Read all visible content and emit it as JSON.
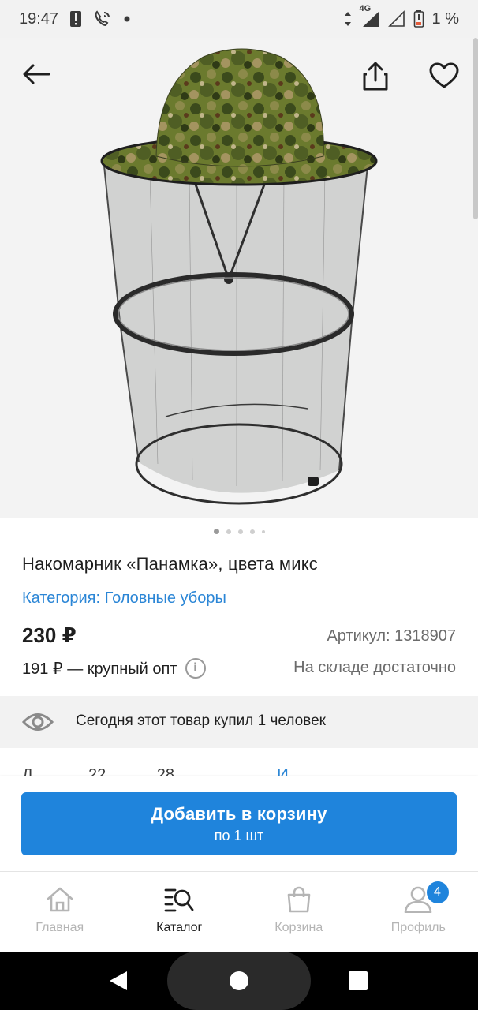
{
  "status_bar": {
    "time": "19:47",
    "network": "4G",
    "battery": "1 %"
  },
  "product": {
    "title": "Накомарник «Панамка», цвета микс",
    "category": "Категория: Головные уборы",
    "price": "230 ₽",
    "article": "Артикул: 1318907",
    "wholesale": "191 ₽ — крупный опт",
    "stock": "На складе достаточно",
    "image_count": 5,
    "active_image": 1
  },
  "social_proof": {
    "text": "Сегодня этот товар купил 1 человек"
  },
  "cart_button": {
    "label": "Добавить в корзину",
    "sublabel": "по 1 шт"
  },
  "bottom_nav": {
    "items": [
      {
        "label": "Главная",
        "icon": "home-icon",
        "active": false
      },
      {
        "label": "Каталог",
        "icon": "catalog-search-icon",
        "active": true
      },
      {
        "label": "Корзина",
        "icon": "bag-icon",
        "active": false
      },
      {
        "label": "Профиль",
        "icon": "profile-icon",
        "active": false,
        "badge": "4"
      }
    ]
  },
  "colors": {
    "accent": "#1f84dc",
    "link": "#2b86d6",
    "muted": "#6b6b6b",
    "inactive_nav": "#b5b5b5"
  }
}
